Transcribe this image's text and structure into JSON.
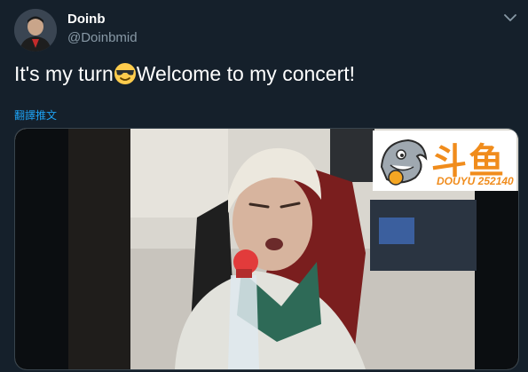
{
  "author": {
    "name": "Doinb",
    "handle": "@Doinbmid"
  },
  "tweet": {
    "text_before": "It's my turn",
    "emoji": "smiling-face-with-sunglasses",
    "text_after": "Welcome to my concert!"
  },
  "translate_link": "翻譯推文",
  "media": {
    "watermark_main": "斗鱼",
    "watermark_sub": "DOUYU 252140"
  },
  "colors": {
    "background": "#15202b",
    "link": "#1da1f2",
    "secondary_text": "#8899a6",
    "border": "#38444d",
    "douyu_orange": "#f08c1c"
  }
}
